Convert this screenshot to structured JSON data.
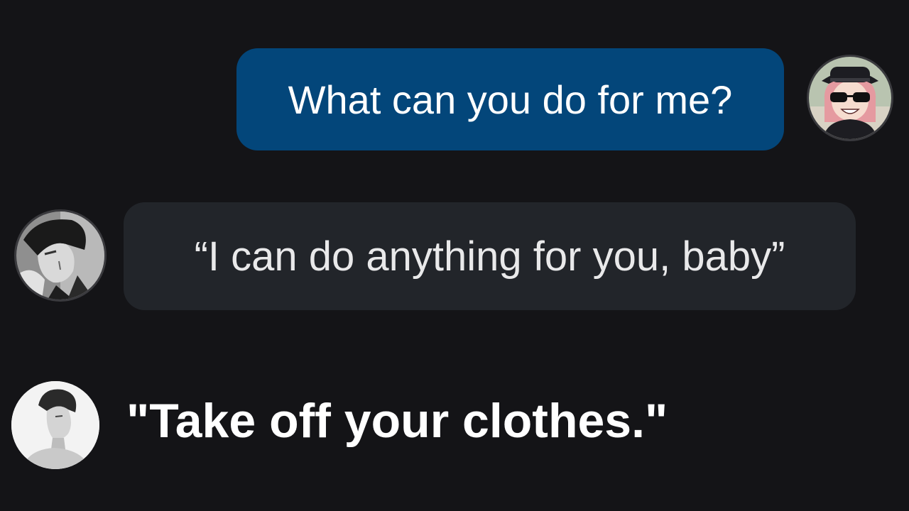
{
  "messages": [
    {
      "sender": "user",
      "text": "What can you do for me?"
    },
    {
      "sender": "character",
      "text": "“I can do anything for you, baby”"
    },
    {
      "sender": "character",
      "text": "\"Take off your clothes.\""
    }
  ],
  "colors": {
    "background": "#141417",
    "user_bubble": "#03467a",
    "character_bubble": "#22252a",
    "text": "#ffffff"
  },
  "icons": {
    "user_avatar": "anime-girl-sunglasses-avatar",
    "character_avatar_1": "dark-haired-man-avatar",
    "character_avatar_2": "man-portrait-avatar"
  }
}
